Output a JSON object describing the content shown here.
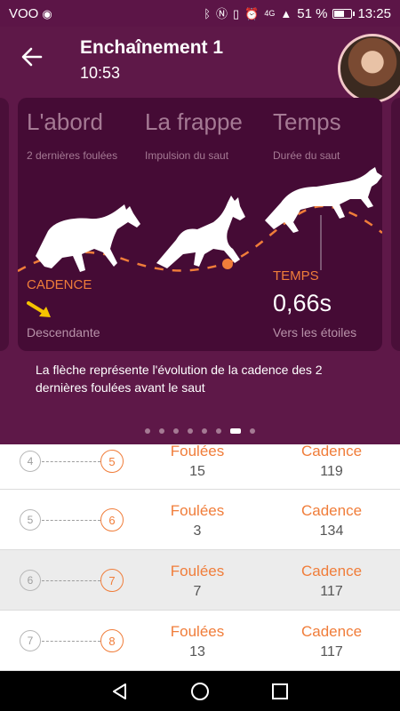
{
  "status_bar": {
    "carrier": "VOO",
    "network": "4G",
    "battery": "51 %",
    "battery_level": 0.51,
    "time": "13:25"
  },
  "header": {
    "title": "Enchaînement 1",
    "subtitle": "10:53"
  },
  "card": {
    "columns": [
      {
        "title": "L'abord",
        "desc": "2 dernières foulées"
      },
      {
        "title": "La frappe",
        "desc": "Impulsion du saut"
      },
      {
        "title": "Temps",
        "desc": "Durée du saut"
      }
    ],
    "cadence_label": "CADENCE",
    "cadence_value": "Descendante",
    "temps_label": "TEMPS",
    "temps_value": "0,66s",
    "temps_desc": "Vers les étoiles",
    "colors": {
      "accent": "#f07d3a",
      "arrow": "#f5c200",
      "header": "#5e1848"
    }
  },
  "explanation": "La flèche représente l'évolution de la cadence des 2 dernières foulées avant le saut",
  "pagination": {
    "count": 8,
    "active_index": 6
  },
  "rows": [
    {
      "from": "4",
      "to": "5",
      "foulees_label": "Foulées",
      "foulees": "15",
      "cadence_label": "Cadence",
      "cadence": "119"
    },
    {
      "from": "5",
      "to": "6",
      "foulees_label": "Foulées",
      "foulees": "3",
      "cadence_label": "Cadence",
      "cadence": "134"
    },
    {
      "from": "6",
      "to": "7",
      "foulees_label": "Foulées",
      "foulees": "7",
      "cadence_label": "Cadence",
      "cadence": "117"
    },
    {
      "from": "7",
      "to": "8",
      "foulees_label": "Foulées",
      "foulees": "13",
      "cadence_label": "Cadence",
      "cadence": "117"
    }
  ],
  "nav": {
    "icons": [
      "back-triangle-icon",
      "home-circle-icon",
      "recents-square-icon"
    ]
  }
}
